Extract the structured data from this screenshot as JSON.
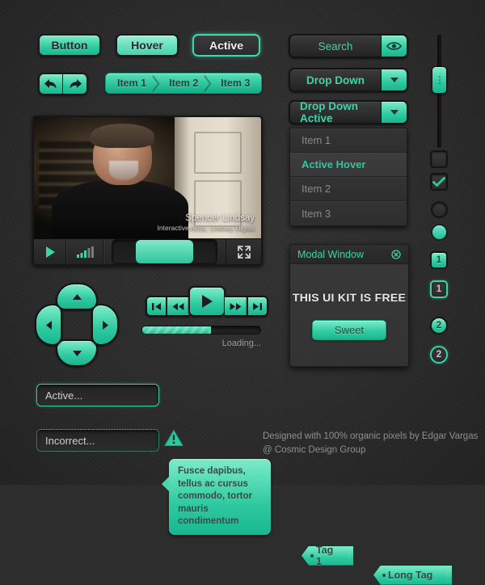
{
  "buttons": {
    "normal": "Button",
    "hover": "Hover",
    "active": "Active"
  },
  "nav": {
    "back_icon": "arrow-back-icon",
    "forward_icon": "arrow-forward-icon"
  },
  "breadcrumb": {
    "items": [
      "Item 1",
      "Item 2",
      "Item 3"
    ]
  },
  "video": {
    "caption_name": "Spencer Lindsay",
    "caption_role": "Interactive Artist, Lindsay Digital",
    "play_icon": "play-icon",
    "volume_icon": "volume-bars-icon",
    "fullscreen_icon": "fullscreen-icon",
    "progress_percent": 55
  },
  "dpad": {
    "up_icon": "triangle-up-icon",
    "down_icon": "triangle-down-icon",
    "left_icon": "triangle-left-icon",
    "right_icon": "triangle-right-icon"
  },
  "media": {
    "prev_icon": "skip-back-icon",
    "rewind_icon": "rewind-icon",
    "play_icon": "play-icon",
    "forward_icon": "fast-forward-icon",
    "next_icon": "skip-forward-icon"
  },
  "loading": {
    "label": "Loading...",
    "percent": 58
  },
  "inputs": {
    "active_value": "Active...",
    "error_value": "Incorrect...",
    "warning_icon": "warning-triangle-icon"
  },
  "tooltip": {
    "text": "Fusce dapibus, tellus ac cursus commodo, tortor mauris condimentum"
  },
  "tags": [
    {
      "label": "Tag 1"
    },
    {
      "label": "Long Tag"
    }
  ],
  "search": {
    "value": "Search",
    "icon": "eye-icon"
  },
  "dropdown": {
    "closed_label": "Drop Down",
    "open_label": "Drop Down Active",
    "caret_icon": "chevron-down-icon",
    "items": [
      {
        "label": "Item 1",
        "state": "normal"
      },
      {
        "label": "Active Hover",
        "state": "hover"
      },
      {
        "label": "Item 2",
        "state": "normal"
      },
      {
        "label": "Item 3",
        "state": "normal"
      }
    ]
  },
  "slider": {
    "value_percent": 28,
    "grip_icon": "drag-grip-icon"
  },
  "toggles": {
    "checkbox_off": "",
    "checkbox_on_icon": "check-icon",
    "radio_off": "",
    "radio_on": "",
    "badge_square_filled": "1",
    "badge_square_outline": "1",
    "badge_circle_filled": "2",
    "badge_circle_outline": "2"
  },
  "modal": {
    "title": "Modal Window",
    "close_icon": "close-circle-icon",
    "message": "THIS UI KIT IS FREE",
    "button_label": "Sweet"
  },
  "credit": {
    "line1": "Designed with 100% organic pixels by Edgar Vargas",
    "line2": "@ Cosmic Design Group"
  },
  "colors": {
    "accent": "#3ed3a9",
    "accent_dark": "#17b78e",
    "background": "#2d2d2d",
    "panel": "#333333",
    "text_muted": "#8f8f8f"
  }
}
